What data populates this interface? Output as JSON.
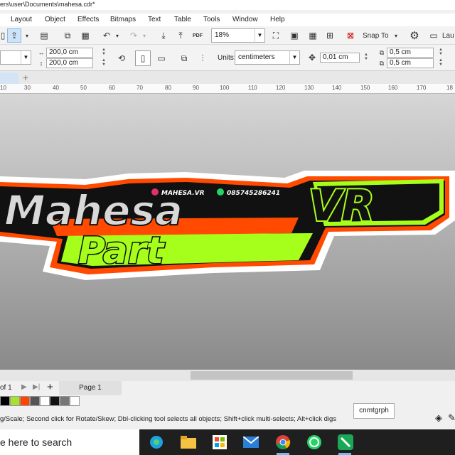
{
  "window": {
    "title": "ers\\user\\Documents\\mahesa.cdr*"
  },
  "menu": [
    "Layout",
    "Object",
    "Effects",
    "Bitmaps",
    "Text",
    "Table",
    "Tools",
    "Window",
    "Help"
  ],
  "toolbar": {
    "zoom": "18%",
    "snap_to": "Snap To",
    "launch": "Lau"
  },
  "props": {
    "width": "200,0 cm",
    "height": "200,0 cm",
    "units_label": "Units:",
    "units": "centimeters",
    "nudge": "0,01 cm",
    "dup_x": "0,5 cm",
    "dup_y": "0,5 cm"
  },
  "ruler": {
    "ticks": [
      "10",
      "30",
      "40",
      "50",
      "60",
      "70",
      "80",
      "90",
      "100",
      "110",
      "120",
      "130",
      "140",
      "150",
      "160",
      "170",
      "18"
    ]
  },
  "logo": {
    "line1": "Mahesa",
    "line2": "VR",
    "line3": "Part",
    "instagram": "MAHESA.VR",
    "phone": "085745286241"
  },
  "pages": {
    "of_label": "of 1",
    "page_tab": "Page 1"
  },
  "palette": {
    "colors": [
      "#000000",
      "#a6e22e",
      "#ff4400",
      "#555555",
      "#ffffff",
      "#111111",
      "#777777",
      "#ffffff"
    ]
  },
  "status": {
    "hint": "g/Scale; Second click for Rotate/Skew; Dbl-clicking tool selects all objects; Shift+click multi-selects; Alt+click digs"
  },
  "tooltip": "cnmtgrph",
  "taskbar": {
    "search": "e here to search"
  },
  "colors": {
    "accent_green": "#a6ff1a",
    "accent_orange": "#ff4a00",
    "logo_black": "#111111"
  }
}
